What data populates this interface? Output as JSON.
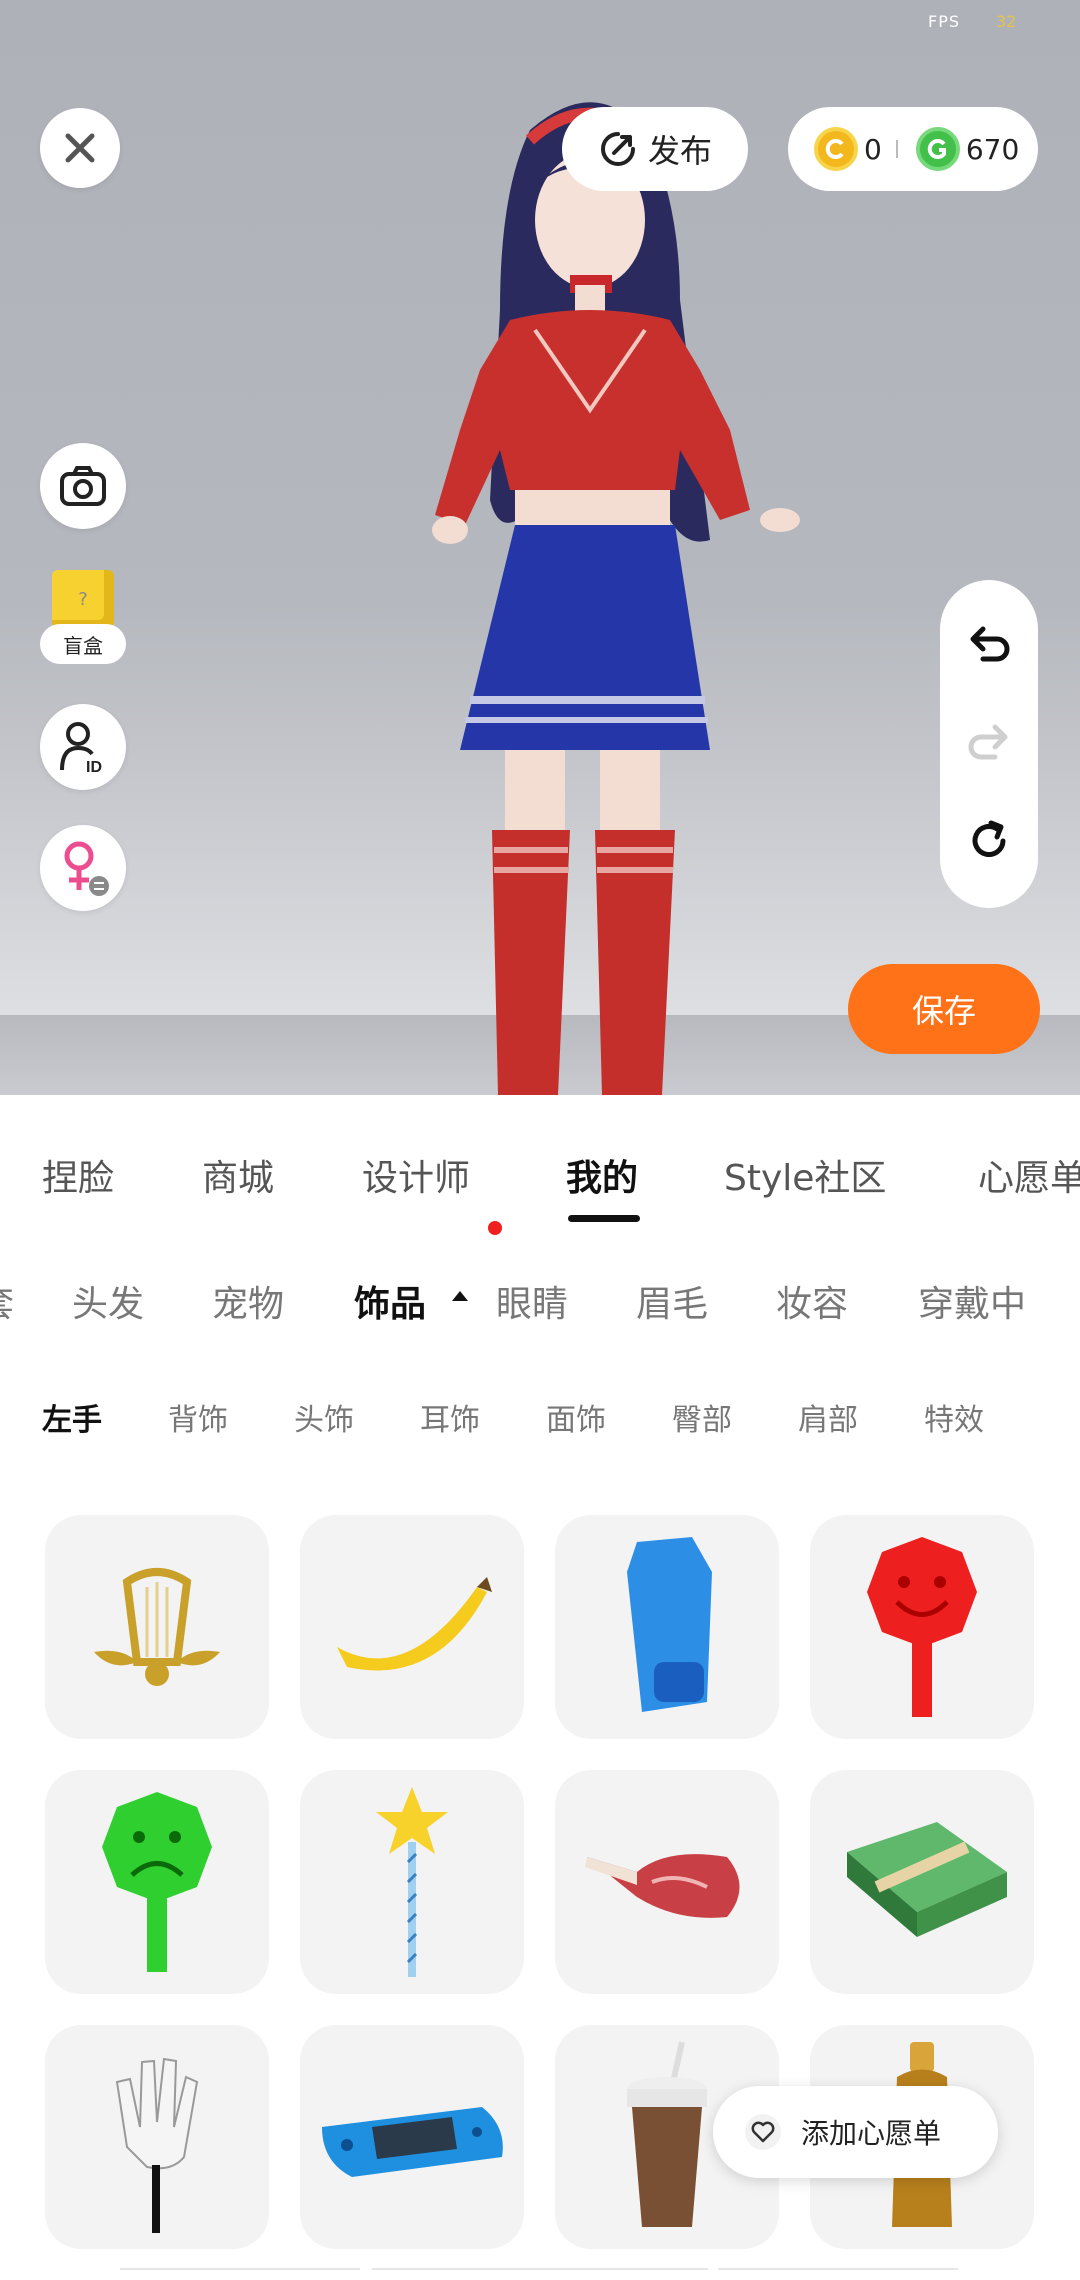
{
  "status": {
    "fps_label": "FPS",
    "fps_value": "32"
  },
  "topbar": {
    "publish_label": "发布",
    "gold_coins": "0",
    "green_coins": "670"
  },
  "left_tools": {
    "blindbox_label": "盲盒"
  },
  "save_label": "保存",
  "main_tabs": [
    {
      "label": "捏脸"
    },
    {
      "label": "商城"
    },
    {
      "label": "设计师"
    },
    {
      "label": "我的"
    },
    {
      "label": "Style社区"
    },
    {
      "label": "心愿单"
    }
  ],
  "category_tabs": [
    {
      "label": "套"
    },
    {
      "label": "头发"
    },
    {
      "label": "宠物"
    },
    {
      "label": "饰品"
    },
    {
      "label": "眼睛"
    },
    {
      "label": "眉毛"
    },
    {
      "label": "妆容"
    },
    {
      "label": "穿戴中"
    }
  ],
  "sub_tabs": [
    {
      "label": "左手"
    },
    {
      "label": "背饰"
    },
    {
      "label": "头饰"
    },
    {
      "label": "耳饰"
    },
    {
      "label": "面饰"
    },
    {
      "label": "臀部"
    },
    {
      "label": "肩部"
    },
    {
      "label": "特效"
    }
  ],
  "items": [
    {
      "icon": "golden-lyre-icon"
    },
    {
      "icon": "banana-icon"
    },
    {
      "icon": "blue-glove-icon"
    },
    {
      "icon": "red-smiley-sign-icon"
    },
    {
      "icon": "green-sad-sign-icon"
    },
    {
      "icon": "star-wand-icon"
    },
    {
      "icon": "meat-icon"
    },
    {
      "icon": "cash-stack-icon"
    },
    {
      "icon": "white-glove-icon"
    },
    {
      "icon": "game-console-icon"
    },
    {
      "icon": "coffee-cup-icon"
    },
    {
      "icon": "bottle-icon"
    }
  ],
  "wishlist_label": "添加心愿单",
  "colors": {
    "accent": "#ff7217",
    "notification": "#f02020"
  }
}
